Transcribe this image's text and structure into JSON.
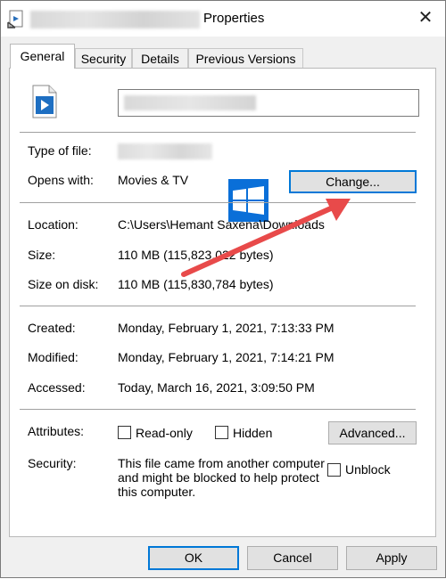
{
  "window": {
    "title": "Properties"
  },
  "tabs": [
    {
      "label": "General"
    },
    {
      "label": "Security"
    },
    {
      "label": "Details"
    },
    {
      "label": "Previous Versions"
    }
  ],
  "general": {
    "type_of_file_label": "Type of file:",
    "opens_with_label": "Opens with:",
    "opens_with_value": "Movies & TV",
    "change_button": "Change...",
    "location_label": "Location:",
    "location_value": "C:\\Users\\Hemant Saxena\\Downloads",
    "size_label": "Size:",
    "size_value": "110 MB (115,823,022 bytes)",
    "size_on_disk_label": "Size on disk:",
    "size_on_disk_value": "110 MB (115,830,784 bytes)",
    "created_label": "Created:",
    "created_value": "Monday, February 1, 2021, 7:13:33 PM",
    "modified_label": "Modified:",
    "modified_value": "Monday, February 1, 2021, 7:14:21 PM",
    "accessed_label": "Accessed:",
    "accessed_value": "Today, March 16, 2021, 3:09:50 PM",
    "attributes_label": "Attributes:",
    "readonly_label": "Read-only",
    "readonly_checked": false,
    "hidden_label": "Hidden",
    "hidden_checked": false,
    "advanced_button": "Advanced...",
    "security_label": "Security:",
    "security_text_1": "This file came from another computer",
    "security_text_2": "and might be blocked to help protect",
    "security_text_3": "this computer.",
    "unblock_label": "Unblock",
    "unblock_checked": false
  },
  "footer": {
    "ok": "OK",
    "cancel": "Cancel",
    "apply": "Apply"
  },
  "annotation": {
    "arrow_color": "#e84a4a"
  },
  "icons": {
    "file_icon": "video-file-icon",
    "app_logo": "windows-logo-icon"
  }
}
